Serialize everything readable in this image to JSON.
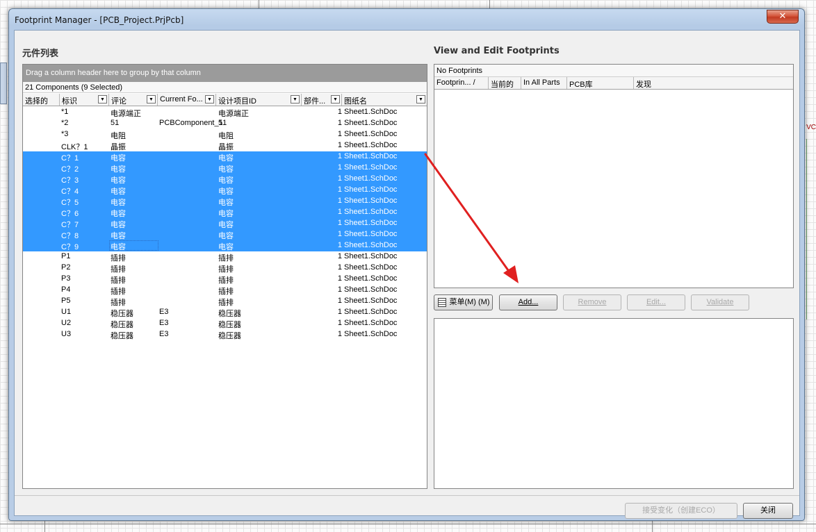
{
  "window": {
    "title": "Footprint Manager - [PCB_Project.PrjPcb]",
    "close_glyph": "✕"
  },
  "background": {
    "vcc_label": "VC"
  },
  "left": {
    "title": "元件列表",
    "group_hint": "Drag a column header here to group by that column",
    "count": "21 Components (9 Selected)",
    "columns": [
      {
        "label": "选择的",
        "dropdown": false
      },
      {
        "label": "标识",
        "dropdown": true
      },
      {
        "label": "评论",
        "dropdown": true
      },
      {
        "label": "Current Fo...",
        "dropdown": true
      },
      {
        "label": "设计项目ID",
        "dropdown": true
      },
      {
        "label": "部件...",
        "dropdown": true
      },
      {
        "label": "图纸名",
        "dropdown": true
      }
    ],
    "rows": [
      {
        "id": "*1",
        "comment": "电源端正",
        "footprint": "",
        "design": "电源端正",
        "part": "1",
        "sheet": "Sheet1.SchDoc",
        "selected": false
      },
      {
        "id": "*2",
        "comment": "51",
        "footprint": "PCBComponent_1",
        "design": "51",
        "part": "1",
        "sheet": "Sheet1.SchDoc",
        "selected": false
      },
      {
        "id": "*3",
        "comment": "电阻",
        "footprint": "",
        "design": "电阻",
        "part": "1",
        "sheet": "Sheet1.SchDoc",
        "selected": false
      },
      {
        "id": "CLK？1",
        "comment": "晶振",
        "footprint": "",
        "design": "晶振",
        "part": "1",
        "sheet": "Sheet1.SchDoc",
        "selected": false
      },
      {
        "id": "C？1",
        "comment": "电容",
        "footprint": "",
        "design": "电容",
        "part": "1",
        "sheet": "Sheet1.SchDoc",
        "selected": true
      },
      {
        "id": "C？2",
        "comment": "电容",
        "footprint": "",
        "design": "电容",
        "part": "1",
        "sheet": "Sheet1.SchDoc",
        "selected": true
      },
      {
        "id": "C？3",
        "comment": "电容",
        "footprint": "",
        "design": "电容",
        "part": "1",
        "sheet": "Sheet1.SchDoc",
        "selected": true
      },
      {
        "id": "C？4",
        "comment": "电容",
        "footprint": "",
        "design": "电容",
        "part": "1",
        "sheet": "Sheet1.SchDoc",
        "selected": true
      },
      {
        "id": "C？5",
        "comment": "电容",
        "footprint": "",
        "design": "电容",
        "part": "1",
        "sheet": "Sheet1.SchDoc",
        "selected": true
      },
      {
        "id": "C？6",
        "comment": "电容",
        "footprint": "",
        "design": "电容",
        "part": "1",
        "sheet": "Sheet1.SchDoc",
        "selected": true
      },
      {
        "id": "C？7",
        "comment": "电容",
        "footprint": "",
        "design": "电容",
        "part": "1",
        "sheet": "Sheet1.SchDoc",
        "selected": true
      },
      {
        "id": "C？8",
        "comment": "电容",
        "footprint": "",
        "design": "电容",
        "part": "1",
        "sheet": "Sheet1.SchDoc",
        "selected": true
      },
      {
        "id": "C？9",
        "comment": "电容",
        "footprint": "",
        "design": "电容",
        "part": "1",
        "sheet": "Sheet1.SchDoc",
        "selected": true
      },
      {
        "id": "P1",
        "comment": "插排",
        "footprint": "",
        "design": "插排",
        "part": "1",
        "sheet": "Sheet1.SchDoc",
        "selected": false
      },
      {
        "id": "P2",
        "comment": "插排",
        "footprint": "",
        "design": "插排",
        "part": "1",
        "sheet": "Sheet1.SchDoc",
        "selected": false
      },
      {
        "id": "P3",
        "comment": "插排",
        "footprint": "",
        "design": "插排",
        "part": "1",
        "sheet": "Sheet1.SchDoc",
        "selected": false
      },
      {
        "id": "P4",
        "comment": "插排",
        "footprint": "",
        "design": "插排",
        "part": "1",
        "sheet": "Sheet1.SchDoc",
        "selected": false
      },
      {
        "id": "P5",
        "comment": "插排",
        "footprint": "",
        "design": "插排",
        "part": "1",
        "sheet": "Sheet1.SchDoc",
        "selected": false
      },
      {
        "id": "U1",
        "comment": "稳压器",
        "footprint": "E3",
        "design": "稳压器",
        "part": "1",
        "sheet": "Sheet1.SchDoc",
        "selected": false
      },
      {
        "id": "U2",
        "comment": "稳压器",
        "footprint": "E3",
        "design": "稳压器",
        "part": "1",
        "sheet": "Sheet1.SchDoc",
        "selected": false
      },
      {
        "id": "U3",
        "comment": "稳压器",
        "footprint": "E3",
        "design": "稳压器",
        "part": "1",
        "sheet": "Sheet1.SchDoc",
        "selected": false
      }
    ]
  },
  "right": {
    "title": "View and Edit Footprints",
    "no_footprints": "No Footprints",
    "columns": [
      "Footprin... /",
      "当前的",
      "In All Parts",
      "PCB库",
      "发现"
    ],
    "buttons": {
      "menu": "菜单(M) (M)",
      "add": "Add...",
      "remove": "Remove",
      "edit": "Edit...",
      "validate": "Validate"
    }
  },
  "footer": {
    "accept": "接受变化（创建ECO）",
    "close": "关闭"
  },
  "colors": {
    "selection": "#3399ff",
    "annotation_arrow": "#e02020"
  }
}
